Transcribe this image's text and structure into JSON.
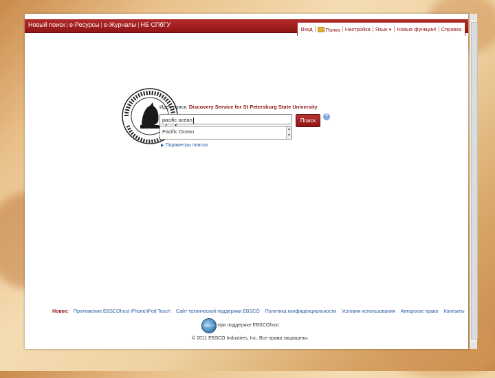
{
  "topnav": {
    "items": [
      "Новый поиск",
      "e-Ресурсы",
      "e-Журналы",
      "НБ СПбГУ"
    ]
  },
  "tools": {
    "items": [
      "Вход",
      "Папка",
      "Настройка",
      "Язык",
      "Новые функции!",
      "Справка"
    ]
  },
  "search": {
    "searching_prefix": "Идет поиск:",
    "profile": "Discovery Service for St Petersburg State University",
    "query": "pacific ocean",
    "button": "Поиск",
    "help": "?",
    "suggestion": "Pacific Ocean",
    "options": "Параметры поиска"
  },
  "footer": {
    "new_label": "Новое:",
    "links": [
      "Приложение EBSCOhost iPhone/iPod Touch",
      "Сайт технической поддержки EBSCO",
      "Политика конфиденциальности",
      "Условия использования",
      "Авторское право",
      "Контакты"
    ],
    "powered_by": "при поддержке EBSCOhost",
    "copyright": "© 2011 EBSCO Industries, Inc. Все права защищены."
  },
  "colors": {
    "brand_red": "#8f1515",
    "link_blue": "#2a5aa8"
  }
}
